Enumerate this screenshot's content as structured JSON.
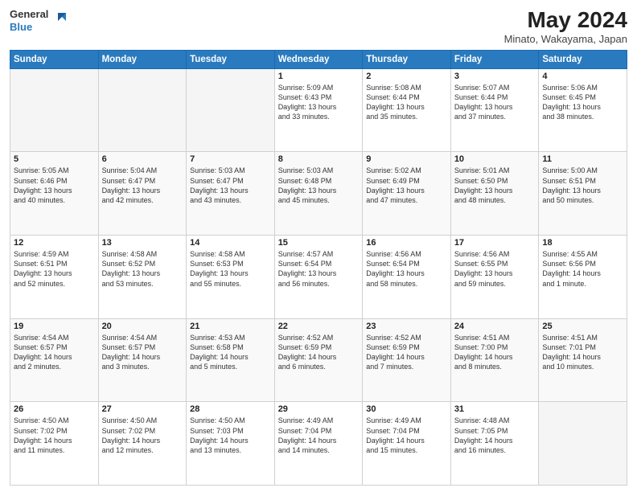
{
  "logo": {
    "line1": "General",
    "line2": "Blue"
  },
  "title": "May 2024",
  "location": "Minato, Wakayama, Japan",
  "weekdays": [
    "Sunday",
    "Monday",
    "Tuesday",
    "Wednesday",
    "Thursday",
    "Friday",
    "Saturday"
  ],
  "rows": [
    [
      {
        "day": "",
        "text": ""
      },
      {
        "day": "",
        "text": ""
      },
      {
        "day": "",
        "text": ""
      },
      {
        "day": "1",
        "text": "Sunrise: 5:09 AM\nSunset: 6:43 PM\nDaylight: 13 hours\nand 33 minutes."
      },
      {
        "day": "2",
        "text": "Sunrise: 5:08 AM\nSunset: 6:44 PM\nDaylight: 13 hours\nand 35 minutes."
      },
      {
        "day": "3",
        "text": "Sunrise: 5:07 AM\nSunset: 6:44 PM\nDaylight: 13 hours\nand 37 minutes."
      },
      {
        "day": "4",
        "text": "Sunrise: 5:06 AM\nSunset: 6:45 PM\nDaylight: 13 hours\nand 38 minutes."
      }
    ],
    [
      {
        "day": "5",
        "text": "Sunrise: 5:05 AM\nSunset: 6:46 PM\nDaylight: 13 hours\nand 40 minutes."
      },
      {
        "day": "6",
        "text": "Sunrise: 5:04 AM\nSunset: 6:47 PM\nDaylight: 13 hours\nand 42 minutes."
      },
      {
        "day": "7",
        "text": "Sunrise: 5:03 AM\nSunset: 6:47 PM\nDaylight: 13 hours\nand 43 minutes."
      },
      {
        "day": "8",
        "text": "Sunrise: 5:03 AM\nSunset: 6:48 PM\nDaylight: 13 hours\nand 45 minutes."
      },
      {
        "day": "9",
        "text": "Sunrise: 5:02 AM\nSunset: 6:49 PM\nDaylight: 13 hours\nand 47 minutes."
      },
      {
        "day": "10",
        "text": "Sunrise: 5:01 AM\nSunset: 6:50 PM\nDaylight: 13 hours\nand 48 minutes."
      },
      {
        "day": "11",
        "text": "Sunrise: 5:00 AM\nSunset: 6:51 PM\nDaylight: 13 hours\nand 50 minutes."
      }
    ],
    [
      {
        "day": "12",
        "text": "Sunrise: 4:59 AM\nSunset: 6:51 PM\nDaylight: 13 hours\nand 52 minutes."
      },
      {
        "day": "13",
        "text": "Sunrise: 4:58 AM\nSunset: 6:52 PM\nDaylight: 13 hours\nand 53 minutes."
      },
      {
        "day": "14",
        "text": "Sunrise: 4:58 AM\nSunset: 6:53 PM\nDaylight: 13 hours\nand 55 minutes."
      },
      {
        "day": "15",
        "text": "Sunrise: 4:57 AM\nSunset: 6:54 PM\nDaylight: 13 hours\nand 56 minutes."
      },
      {
        "day": "16",
        "text": "Sunrise: 4:56 AM\nSunset: 6:54 PM\nDaylight: 13 hours\nand 58 minutes."
      },
      {
        "day": "17",
        "text": "Sunrise: 4:56 AM\nSunset: 6:55 PM\nDaylight: 13 hours\nand 59 minutes."
      },
      {
        "day": "18",
        "text": "Sunrise: 4:55 AM\nSunset: 6:56 PM\nDaylight: 14 hours\nand 1 minute."
      }
    ],
    [
      {
        "day": "19",
        "text": "Sunrise: 4:54 AM\nSunset: 6:57 PM\nDaylight: 14 hours\nand 2 minutes."
      },
      {
        "day": "20",
        "text": "Sunrise: 4:54 AM\nSunset: 6:57 PM\nDaylight: 14 hours\nand 3 minutes."
      },
      {
        "day": "21",
        "text": "Sunrise: 4:53 AM\nSunset: 6:58 PM\nDaylight: 14 hours\nand 5 minutes."
      },
      {
        "day": "22",
        "text": "Sunrise: 4:52 AM\nSunset: 6:59 PM\nDaylight: 14 hours\nand 6 minutes."
      },
      {
        "day": "23",
        "text": "Sunrise: 4:52 AM\nSunset: 6:59 PM\nDaylight: 14 hours\nand 7 minutes."
      },
      {
        "day": "24",
        "text": "Sunrise: 4:51 AM\nSunset: 7:00 PM\nDaylight: 14 hours\nand 8 minutes."
      },
      {
        "day": "25",
        "text": "Sunrise: 4:51 AM\nSunset: 7:01 PM\nDaylight: 14 hours\nand 10 minutes."
      }
    ],
    [
      {
        "day": "26",
        "text": "Sunrise: 4:50 AM\nSunset: 7:02 PM\nDaylight: 14 hours\nand 11 minutes."
      },
      {
        "day": "27",
        "text": "Sunrise: 4:50 AM\nSunset: 7:02 PM\nDaylight: 14 hours\nand 12 minutes."
      },
      {
        "day": "28",
        "text": "Sunrise: 4:50 AM\nSunset: 7:03 PM\nDaylight: 14 hours\nand 13 minutes."
      },
      {
        "day": "29",
        "text": "Sunrise: 4:49 AM\nSunset: 7:04 PM\nDaylight: 14 hours\nand 14 minutes."
      },
      {
        "day": "30",
        "text": "Sunrise: 4:49 AM\nSunset: 7:04 PM\nDaylight: 14 hours\nand 15 minutes."
      },
      {
        "day": "31",
        "text": "Sunrise: 4:48 AM\nSunset: 7:05 PM\nDaylight: 14 hours\nand 16 minutes."
      },
      {
        "day": "",
        "text": ""
      }
    ]
  ],
  "accent_color": "#2a7abf"
}
